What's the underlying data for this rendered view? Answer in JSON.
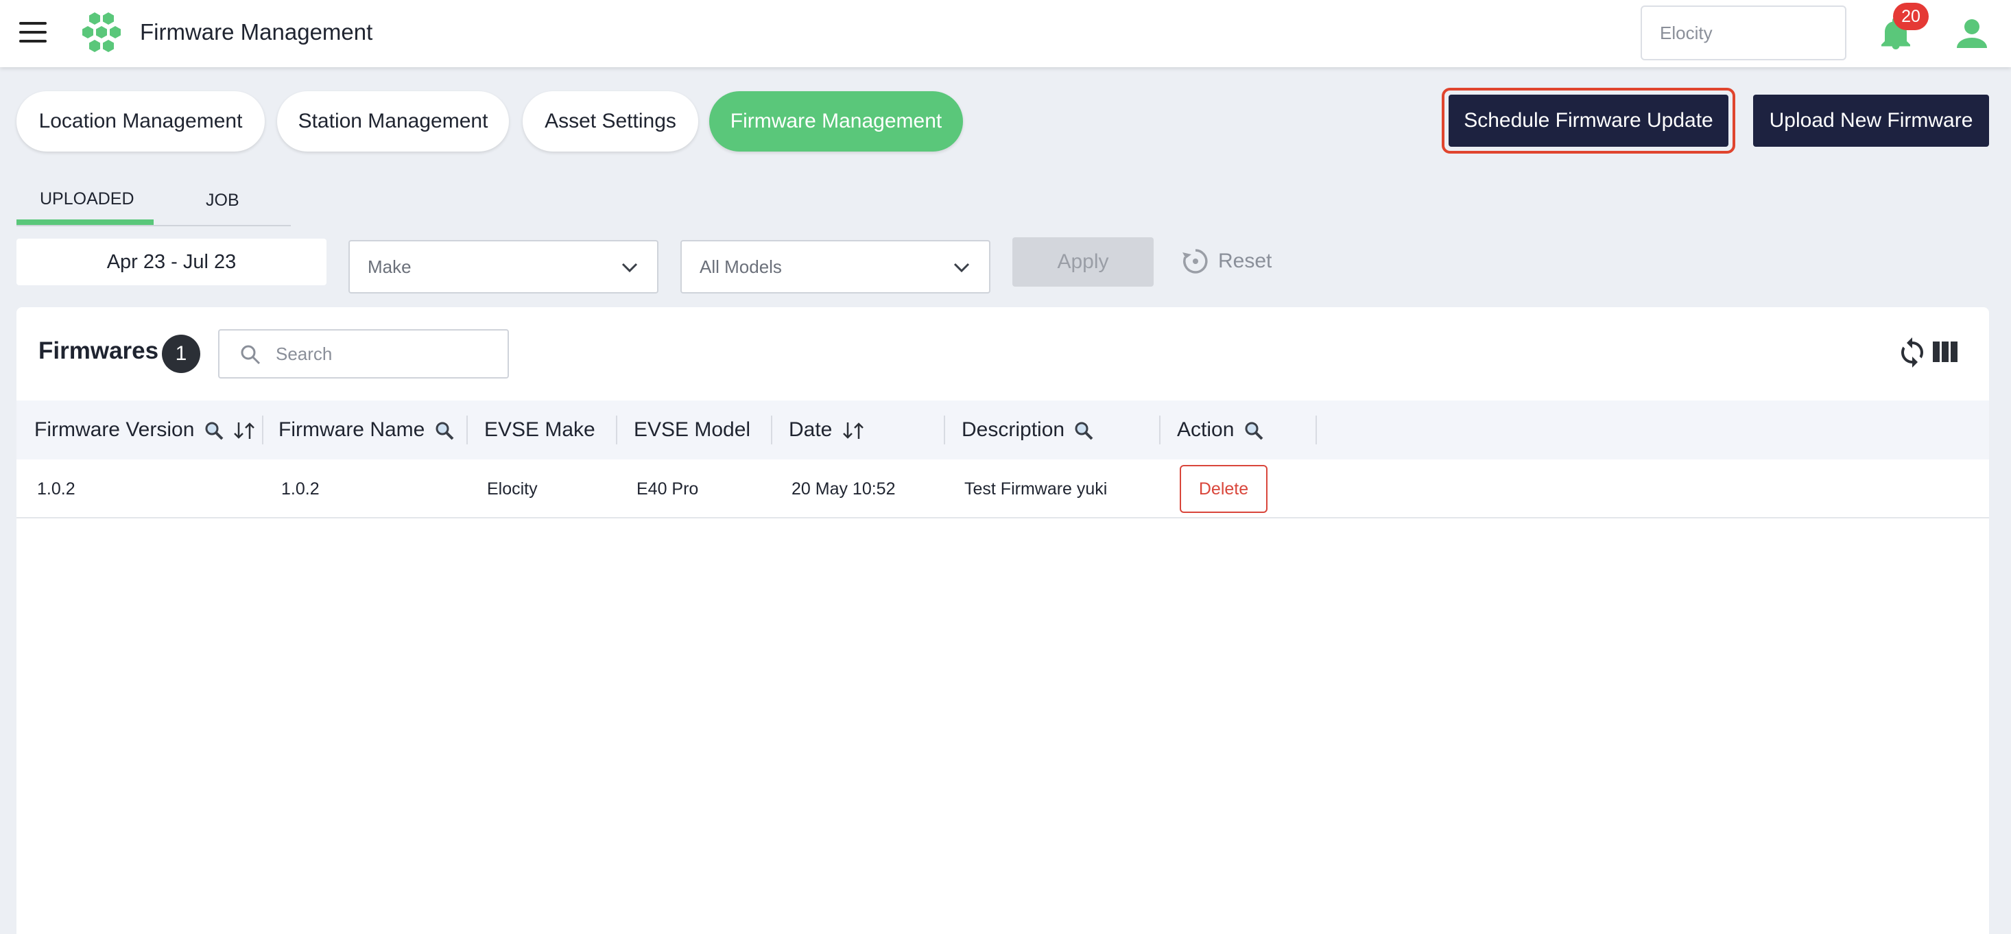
{
  "header": {
    "title": "Firmware Management",
    "tenant_value": "Elocity",
    "notification_count": "20"
  },
  "nav_pills": [
    {
      "label": "Location Management",
      "active": false
    },
    {
      "label": "Station Management",
      "active": false
    },
    {
      "label": "Asset Settings",
      "active": false
    },
    {
      "label": "Firmware Management",
      "active": true
    }
  ],
  "actions": {
    "schedule_label": "Schedule Firmware Update",
    "upload_label": "Upload New Firmware"
  },
  "tabs": [
    {
      "label": "UPLOADED",
      "active": true
    },
    {
      "label": "JOB",
      "active": false
    }
  ],
  "filters": {
    "date_range": "Apr 23 - Jul 23",
    "make_placeholder": "Make",
    "model_value": "All Models",
    "apply_label": "Apply",
    "reset_label": "Reset"
  },
  "table": {
    "title": "Firmwares",
    "count": "1",
    "search_placeholder": "Search",
    "columns": {
      "firmware_version": "Firmware Version",
      "firmware_name": "Firmware Name",
      "evse_make": "EVSE Make",
      "evse_model": "EVSE Model",
      "date": "Date",
      "description": "Description",
      "action": "Action"
    },
    "rows": [
      {
        "firmware_version": "1.0.2",
        "firmware_name": "1.0.2",
        "evse_make": "Elocity",
        "evse_model": "E40 Pro",
        "date": "20 May 10:52",
        "description": "Test Firmware yuki",
        "action_label": "Delete"
      }
    ]
  },
  "colors": {
    "accent_green": "#5ac77a",
    "dark_button": "#1d2240",
    "danger": "#d9463b",
    "highlight": "#e0452e"
  }
}
